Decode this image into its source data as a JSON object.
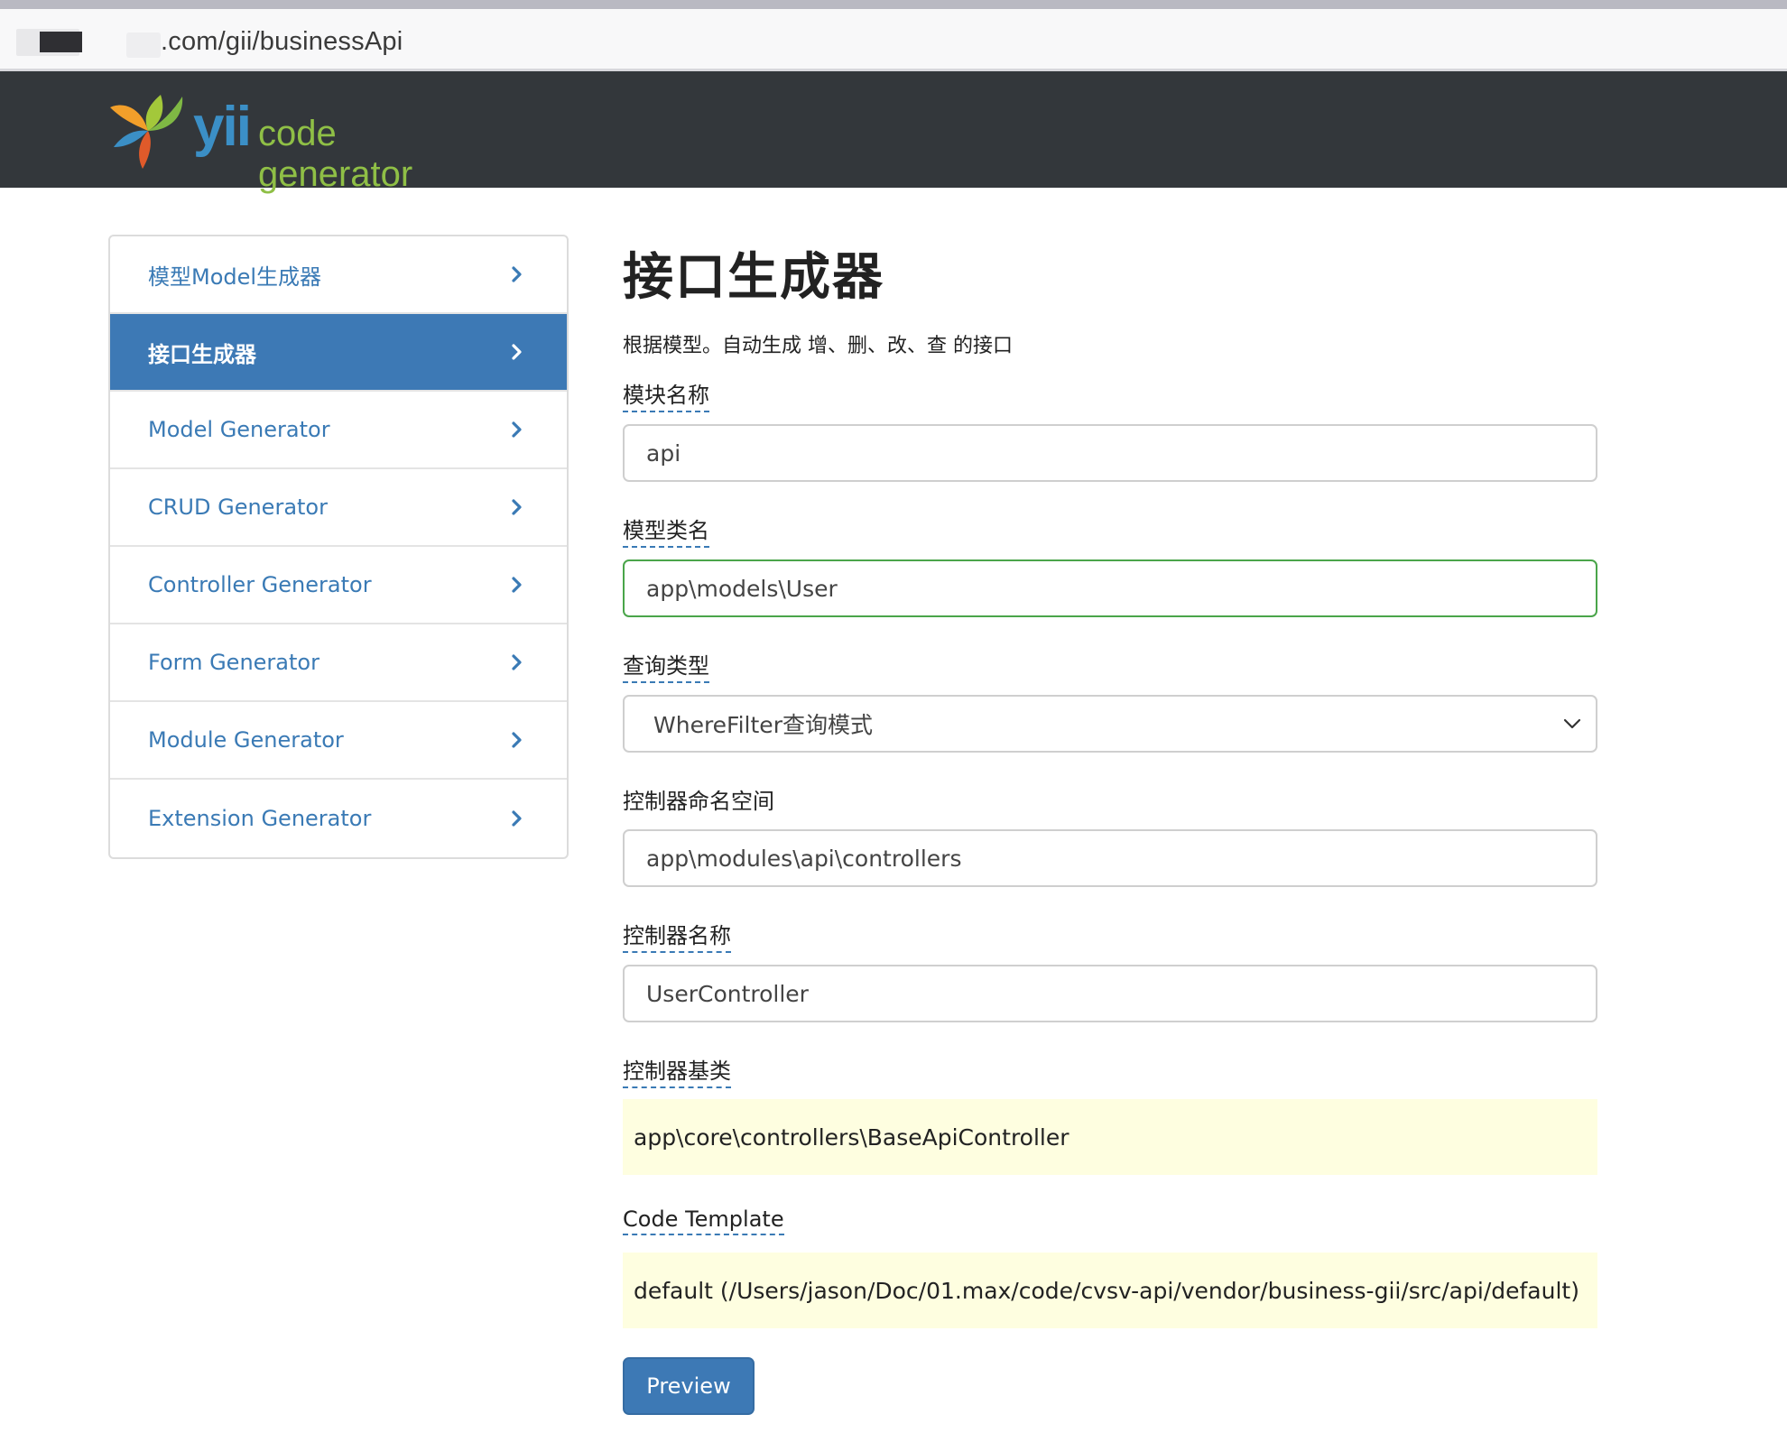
{
  "browser": {
    "url": ".com/gii/businessApi"
  },
  "header": {
    "logo_yii": "yii",
    "logo_text": "code generator"
  },
  "sidebar": {
    "items": [
      {
        "label": "模型Model生成器",
        "active": false
      },
      {
        "label": "接口生成器",
        "active": true
      },
      {
        "label": "Model Generator",
        "active": false
      },
      {
        "label": "CRUD Generator",
        "active": false
      },
      {
        "label": "Controller Generator",
        "active": false
      },
      {
        "label": "Form Generator",
        "active": false
      },
      {
        "label": "Module Generator",
        "active": false
      },
      {
        "label": "Extension Generator",
        "active": false
      }
    ]
  },
  "main": {
    "title": "接口生成器",
    "description": "根据模型。自动生成 增、删、改、查 的接口",
    "fields": {
      "module_name": {
        "label": "模块名称",
        "value": "api"
      },
      "model_class": {
        "label": "模型类名",
        "value": "app\\models\\User"
      },
      "query_type": {
        "label": "查询类型",
        "value": "WhereFilter查询模式"
      },
      "controller_namespace": {
        "label": "控制器命名空间",
        "value": "app\\modules\\api\\controllers"
      },
      "controller_name": {
        "label": "控制器名称",
        "value": "UserController"
      },
      "controller_base": {
        "label": "控制器基类",
        "value": "app\\core\\controllers\\BaseApiController"
      },
      "code_template": {
        "label": "Code Template",
        "value": "default (/Users/jason/Doc/01.max/code/cvsv-api/vendor/business-gii/src/api/default)"
      }
    },
    "preview_label": "Preview"
  },
  "colors": {
    "header_bg": "#33373b",
    "accent": "#3d79b5",
    "link": "#3a7ab5",
    "success_border": "#4aa54a",
    "sticky_bg": "#fefee0"
  }
}
